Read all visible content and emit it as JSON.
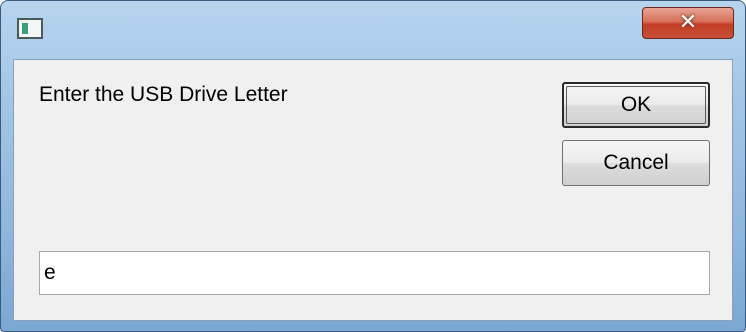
{
  "window": {
    "title_icon": "application-icon",
    "close_glyph": "✕",
    "close_icon": "close-icon"
  },
  "dialog": {
    "prompt": "Enter the USB Drive Letter",
    "input_value": "e",
    "ok_label": "OK",
    "cancel_label": "Cancel"
  },
  "colors": {
    "title_bar": "#a3c6e6",
    "close_button": "#c8503a",
    "client_background": "#f0f0f0"
  }
}
